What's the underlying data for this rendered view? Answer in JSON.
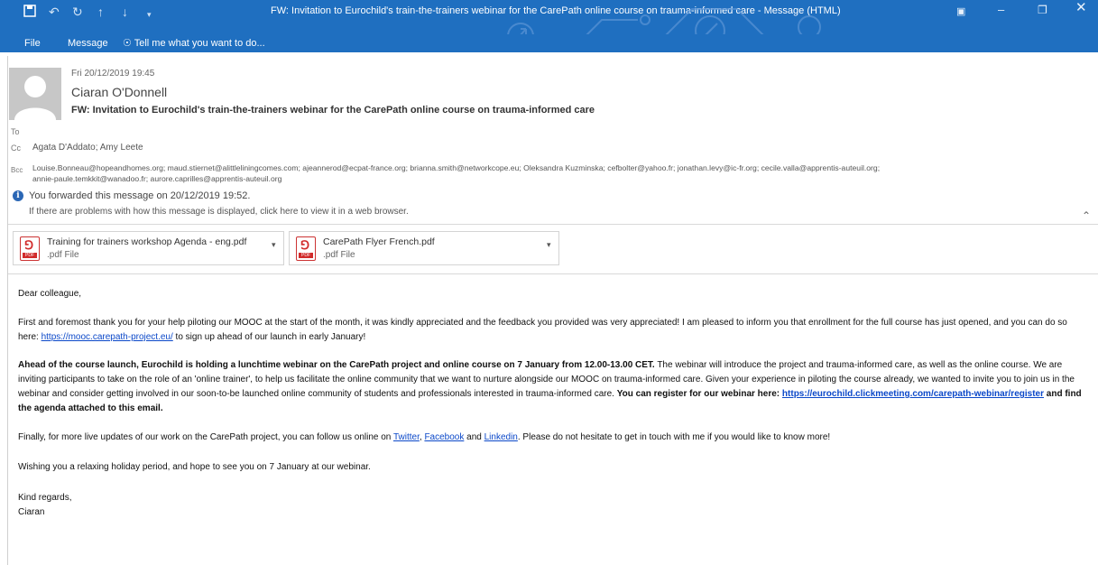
{
  "window": {
    "title": "FW: Invitation to Eurochild's train-the-trainers webinar for the CarePath online course on trauma-informed care - Message (HTML)",
    "colors": {
      "ribbon": "#1f6fc0",
      "link": "#0b48c9",
      "info": "#2b67b5",
      "pdf": "#d12b2b"
    }
  },
  "menu": {
    "file": "File",
    "message": "Message",
    "tell_me": "Tell me what you want to do..."
  },
  "message": {
    "date": "Fri 20/12/2019 19:45",
    "sender": "Ciaran O'Donnell",
    "subject": "FW: Invitation to Eurochild's train-the-trainers webinar for the CarePath online course on trauma-informed care",
    "to_label": "To",
    "cc_label": "Cc",
    "cc": "Agata D'Addato; Amy Leete",
    "bcc_label": "Bcc",
    "bcc_line1": "Louise.Bonneau@hopeandhomes.org; maud.stiernet@alittleliningcomes.com; ajeannerod@ecpat-france.org; brianna.smith@networkcope.eu; Oleksandra Kuzminska; cefbolter@yahoo.fr; jonathan.levy@ic-fr.org; cecile.valla@apprentis-auteuil.org;",
    "bcc_line2": "annie-paule.temkkit@wanadoo.fr; aurore.caprilles@apprentis-auteuil.org",
    "forwarded": "You forwarded this message on 20/12/2019 19:52.",
    "problem": "If there are problems with how this message is displayed, click here to view it in a web browser."
  },
  "attachments": [
    {
      "name": "Training for trainers workshop Agenda - eng.pdf",
      "type": ".pdf File"
    },
    {
      "name": "CarePath Flyer French.pdf",
      "type": ".pdf File"
    }
  ],
  "body": {
    "greeting": "Dear colleague,",
    "p1_a": "First and foremost thank you for your help piloting our MOOC at the start of the month, it was kindly appreciated and the feedback you provided was very appreciated! I am pleased to inform you that enrollment for the full course has just opened, and you can do so here: ",
    "p1_link": "https://mooc.carepath-project.eu/",
    "p1_b": " to sign up ahead of our launch in early January!",
    "p2_bold": "Ahead of the course launch, Eurochild is holding a lunchtime webinar on the CarePath project and online course on 7 January from 12.00-13.00 CET.",
    "p2_text": " The webinar will introduce the project and trauma-informed care, as well as the online course. We are inviting participants to take on the role of an 'online trainer', to help us facilitate the online community that we want to nurture alongside our MOOC on trauma-informed care. Given your experience in piloting the course already, we wanted to invite you to join us in the webinar and consider getting involved in our soon-to-be launched online community of students and professionals interested in trauma-informed care. ",
    "p2_bold2": "You can register for our webinar here: ",
    "p2_link": "https://eurochild.clickmeeting.com/carepath-webinar/register",
    "p2_bold3": " and find the agenda attached to this email.",
    "p3_a": "Finally, for more live updates of our work on the CarePath project, you can follow us online on ",
    "p3_twitter": "Twitter",
    "p3_sep": ", ",
    "p3_facebook": "Facebook",
    "p3_and": " and ",
    "p3_linkedin": "Linkedin",
    "p3_b": ". Please do not hesitate to get in touch with me if you would like to know more!",
    "p4": "Wishing you a relaxing holiday period, and hope to see you on 7 January at our webinar.",
    "closing": "Kind regards,",
    "signature": "Ciaran"
  }
}
